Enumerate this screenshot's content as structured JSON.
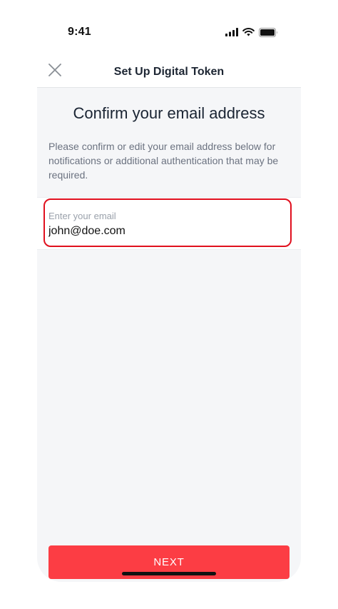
{
  "status_bar": {
    "time": "9:41",
    "icons": [
      "cellular-signal-icon",
      "wifi-icon",
      "battery-icon"
    ]
  },
  "nav": {
    "title": "Set Up Digital Token",
    "close_icon": "close-icon"
  },
  "main": {
    "heading": "Confirm your email address",
    "description": "Please confirm or edit your email address below for notifications or additional authentication that may be required.",
    "email": {
      "placeholder": "Enter your email",
      "value": "john@doe.com"
    },
    "next_label": "NEXT"
  },
  "colors": {
    "accent_button": "#fc3d44",
    "highlight_border": "#e0101e",
    "content_background": "#f5f6f8"
  }
}
